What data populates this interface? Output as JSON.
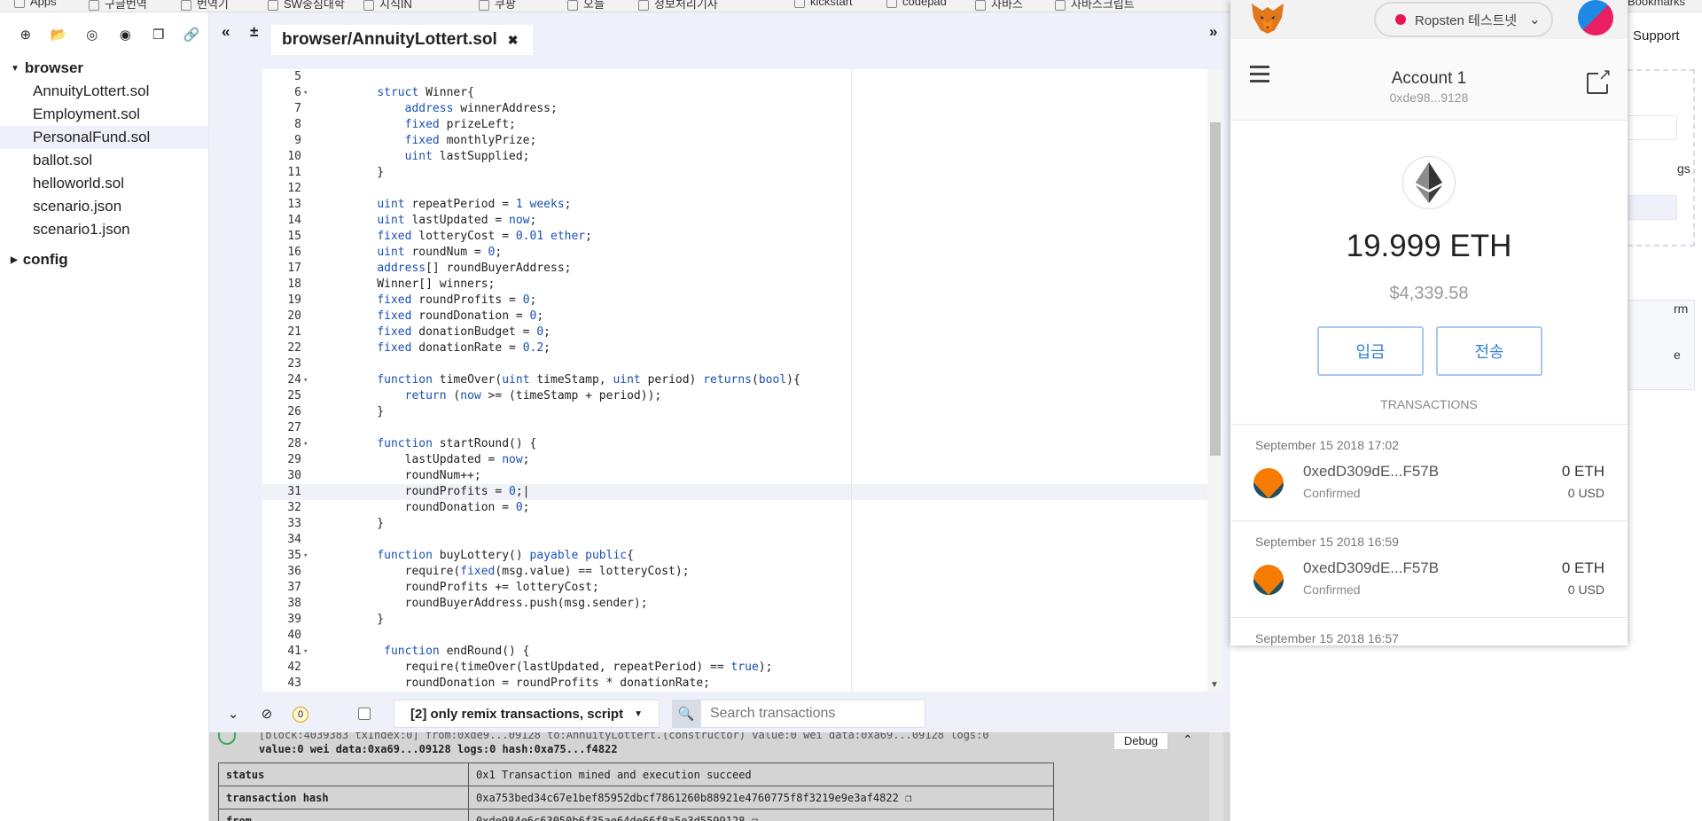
{
  "bookmarks": [
    "Apps",
    "구글번역",
    "번역기",
    "SW중심대학",
    "지식IN",
    "쿠팡",
    "오늘",
    "정보처리기사",
    "kickstart",
    "codepad",
    "자바스",
    "자바스크립트",
    "Bookmarks"
  ],
  "file_explorer": {
    "browser_label": "browser",
    "files": [
      "AnnuityLottert.sol",
      "Employment.sol",
      "PersonalFund.sol",
      "ballot.sol",
      "helloworld.sol",
      "scenario.json",
      "scenario1.json"
    ],
    "selected_file": "PersonalFund.sol",
    "config_label": "config"
  },
  "editor": {
    "tab_title": "browser/AnnuityLottert.sol",
    "close_glyph": "✖",
    "highlighted_line": 31,
    "lines": [
      {
        "n": 5,
        "t": "",
        "fold": false
      },
      {
        "n": 6,
        "t": "    struct Winner{",
        "fold": true
      },
      {
        "n": 7,
        "t": "        address winnerAddress;",
        "fold": false
      },
      {
        "n": 8,
        "t": "        fixed prizeLeft;",
        "fold": false
      },
      {
        "n": 9,
        "t": "        fixed monthlyPrize;",
        "fold": false
      },
      {
        "n": 10,
        "t": "        uint lastSupplied;",
        "fold": false
      },
      {
        "n": 11,
        "t": "    }",
        "fold": false
      },
      {
        "n": 12,
        "t": "",
        "fold": false
      },
      {
        "n": 13,
        "t": "    uint repeatPeriod = 1 weeks;",
        "fold": false
      },
      {
        "n": 14,
        "t": "    uint lastUpdated = now;",
        "fold": false
      },
      {
        "n": 15,
        "t": "    fixed lotteryCost = 0.01 ether;",
        "fold": false
      },
      {
        "n": 16,
        "t": "    uint roundNum = 0;",
        "fold": false
      },
      {
        "n": 17,
        "t": "    address[] roundBuyerAddress;",
        "fold": false
      },
      {
        "n": 18,
        "t": "    Winner[] winners;",
        "fold": false
      },
      {
        "n": 19,
        "t": "    fixed roundProfits = 0;",
        "fold": false
      },
      {
        "n": 20,
        "t": "    fixed roundDonation = 0;",
        "fold": false
      },
      {
        "n": 21,
        "t": "    fixed donationBudget = 0;",
        "fold": false
      },
      {
        "n": 22,
        "t": "    fixed donationRate = 0.2;",
        "fold": false
      },
      {
        "n": 23,
        "t": "",
        "fold": false
      },
      {
        "n": 24,
        "t": "    function timeOver(uint timeStamp, uint period) returns(bool){",
        "fold": true
      },
      {
        "n": 25,
        "t": "        return (now >= (timeStamp + period));",
        "fold": false
      },
      {
        "n": 26,
        "t": "    }",
        "fold": false
      },
      {
        "n": 27,
        "t": "",
        "fold": false
      },
      {
        "n": 28,
        "t": "    function startRound() {",
        "fold": true
      },
      {
        "n": 29,
        "t": "        lastUpdated = now;",
        "fold": false
      },
      {
        "n": 30,
        "t": "        roundNum++;",
        "fold": false
      },
      {
        "n": 31,
        "t": "        roundProfits = 0;|",
        "fold": false
      },
      {
        "n": 32,
        "t": "        roundDonation = 0;",
        "fold": false
      },
      {
        "n": 33,
        "t": "    }",
        "fold": false
      },
      {
        "n": 34,
        "t": "",
        "fold": false
      },
      {
        "n": 35,
        "t": "    function buyLottery() payable public{",
        "fold": true
      },
      {
        "n": 36,
        "t": "        require(fixed(msg.value) == lotteryCost);",
        "fold": false
      },
      {
        "n": 37,
        "t": "        roundProfits += lotteryCost;",
        "fold": false
      },
      {
        "n": 38,
        "t": "        roundBuyerAddress.push(msg.sender);",
        "fold": false
      },
      {
        "n": 39,
        "t": "    }",
        "fold": false
      },
      {
        "n": 40,
        "t": "",
        "fold": false
      },
      {
        "n": 41,
        "t": "     function endRound() {",
        "fold": true
      },
      {
        "n": 42,
        "t": "        require(timeOver(lastUpdated, repeatPeriod) == true);",
        "fold": false
      },
      {
        "n": 43,
        "t": "        roundDonation = roundProfits * donationRate;",
        "fold": false
      }
    ]
  },
  "terminal": {
    "pending_count": "0",
    "filter_label": "[2] only remix transactions, script",
    "search_placeholder": "Search transactions",
    "log_top": "[block:4039383 txIndex:0]  from:0xde9...09128 to:AnnuityLottert.(constructor) value:0 wei data:0xa69...09128 logs:0",
    "log_line": "value:0 wei data:0xa69...09128 logs:0 hash:0xa75...f4822",
    "debug_label": "Debug",
    "table": [
      {
        "k": "status",
        "v": "0x1 Transaction mined and execution succeed"
      },
      {
        "k": "transaction hash",
        "v": "0xa753bed34c67e1bef85952dbcf7861260b88921e4760775f8f3219e9e3af4822"
      },
      {
        "k": "from",
        "v": "0xde984e6c63050b6f35ae64de66f8a5e3d5599128"
      }
    ]
  },
  "right_panel": {
    "support_label": "Support",
    "partial_labels": [
      "gs",
      "rm",
      "e"
    ]
  },
  "metamask": {
    "network": "Ropsten 테스트넷",
    "network_color": "#e91550",
    "account_name": "Account 1",
    "account_address": "0xde98...9128",
    "balance": "19.999 ETH",
    "fiat": "$4,339.58",
    "deposit_label": "입금",
    "send_label": "전송",
    "transactions_label": "TRANSACTIONS",
    "transactions": [
      {
        "date": "September 15 2018 17:02",
        "address": "0xedD309dE...F57B",
        "status": "Confirmed",
        "eth": "0 ETH",
        "usd": "0 USD"
      },
      {
        "date": "September 15 2018 16:59",
        "address": "0xedD309dE...F57B",
        "status": "Confirmed",
        "eth": "0 ETH",
        "usd": "0 USD"
      },
      {
        "date": "September 15 2018 16:57",
        "address": "",
        "status": "",
        "eth": "",
        "usd": ""
      }
    ]
  }
}
